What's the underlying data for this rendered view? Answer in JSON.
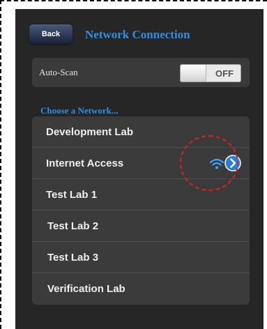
{
  "header": {
    "back_label": "Back",
    "title": "Network Connection"
  },
  "autoscan": {
    "label": "Auto-Scan",
    "state": "OFF"
  },
  "networks": {
    "section_title": "Choose a Network...",
    "items": [
      {
        "label": "Development Lab"
      },
      {
        "label": "Internet Access",
        "connected": true
      },
      {
        "label": "Test Lab 1"
      },
      {
        "label": "Test Lab 2"
      },
      {
        "label": "Test Lab 3"
      },
      {
        "label": "Verification Lab"
      }
    ]
  },
  "icons": {
    "wifi": "wifi-icon",
    "disclosure": "chevron-right-icon"
  },
  "colors": {
    "accent": "#2f8fe0",
    "panel": "#262626",
    "highlight": "#e02020"
  }
}
